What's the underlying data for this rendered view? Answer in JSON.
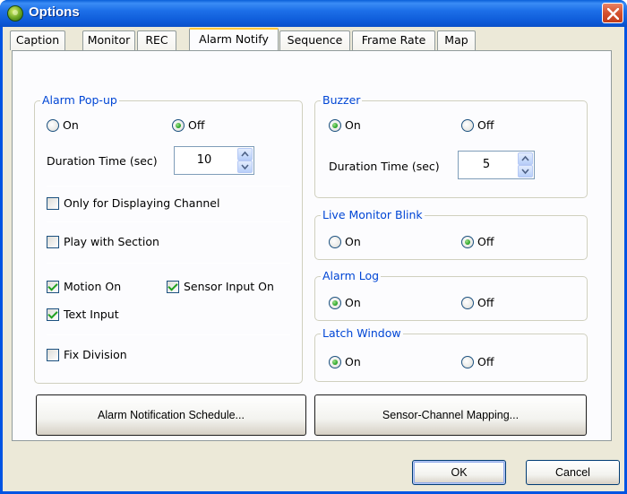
{
  "window": {
    "title": "Options"
  },
  "tabs": [
    {
      "label": "Caption"
    },
    {
      "label": "Monitor"
    },
    {
      "label": "REC"
    },
    {
      "label": "Alarm Notify"
    },
    {
      "label": "Sequence"
    },
    {
      "label": "Frame Rate"
    },
    {
      "label": "Map"
    }
  ],
  "active_tab": "Alarm Notify",
  "alarm_popup": {
    "title": "Alarm Pop-up",
    "on_label": "On",
    "off_label": "Off",
    "selected": "Off",
    "duration_label": "Duration Time (sec)",
    "duration_value": "10",
    "only_displaying_label": "Only for Displaying Channel",
    "only_displaying_checked": false,
    "play_section_label": "Play with Section",
    "play_section_checked": false,
    "motion_on_label": "Motion On",
    "motion_on_checked": true,
    "sensor_input_label": "Sensor Input On",
    "sensor_input_checked": true,
    "text_input_label": "Text Input",
    "text_input_checked": true,
    "fix_division_label": "Fix Division",
    "fix_division_checked": false
  },
  "buzzer": {
    "title": "Buzzer",
    "on_label": "On",
    "off_label": "Off",
    "selected": "On",
    "duration_label": "Duration Time (sec)",
    "duration_value": "5"
  },
  "live_monitor_blink": {
    "title": "Live Monitor Blink",
    "on_label": "On",
    "off_label": "Off",
    "selected": "Off"
  },
  "alarm_log": {
    "title": "Alarm Log",
    "on_label": "On",
    "off_label": "Off",
    "selected": "On"
  },
  "latch_window": {
    "title": "Latch Window",
    "on_label": "On",
    "off_label": "Off",
    "selected": "On"
  },
  "buttons": {
    "schedule": "Alarm Notification Schedule...",
    "mapping": "Sensor-Channel Mapping...",
    "ok": "OK",
    "cancel": "Cancel"
  },
  "colors": {
    "titlebar": "#0054e3",
    "group_title": "#0046d5",
    "dialog_bg": "#ece9d8",
    "check_mark": "#21a121"
  },
  "icons": {
    "app": "app-globe-icon",
    "close": "close-icon"
  }
}
